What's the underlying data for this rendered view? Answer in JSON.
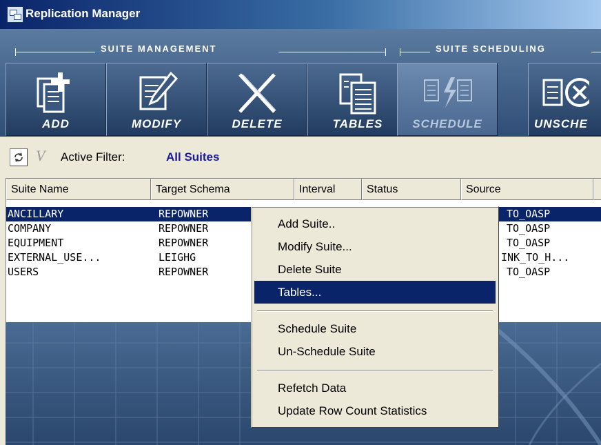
{
  "window": {
    "title": "Replication Manager",
    "icon": "replication-app-icon"
  },
  "toolbar": {
    "sections": [
      {
        "label": "SUITE MANAGEMENT"
      },
      {
        "label": "SUITE SCHEDULING"
      }
    ],
    "buttons": [
      {
        "label": "ADD",
        "icon": "add-document-icon",
        "enabled": true
      },
      {
        "label": "MODIFY",
        "icon": "edit-document-icon",
        "enabled": true
      },
      {
        "label": "DELETE",
        "icon": "delete-x-icon",
        "enabled": true
      },
      {
        "label": "TABLES",
        "icon": "tables-icon",
        "enabled": true
      },
      {
        "label": "SCHEDULE",
        "icon": "schedule-icon",
        "enabled": false
      },
      {
        "label": "UNSCHE",
        "icon": "unschedule-icon",
        "enabled": true
      }
    ]
  },
  "filter_bar": {
    "refresh_icon": "refresh-icon",
    "filter_icon": "filter-icon",
    "active_filter_label": "Active Filter:",
    "active_filter_value": "All Suites"
  },
  "list": {
    "columns": [
      "Suite Name",
      "Target Schema",
      "Interval",
      "Status",
      "Source",
      ""
    ],
    "rows": [
      {
        "suite": "ANCILLARY",
        "schema": "REPOWNER",
        "source": "TO_OASP",
        "selected": true
      },
      {
        "suite": "COMPANY",
        "schema": "REPOWNER",
        "source": "TO_OASP",
        "selected": false
      },
      {
        "suite": "EQUIPMENT",
        "schema": "REPOWNER",
        "source": "TO_OASP",
        "selected": false
      },
      {
        "suite": "EXTERNAL_USE...",
        "schema": "LEIGHG",
        "source": "INK_TO_H...",
        "selected": false
      },
      {
        "suite": "USERS",
        "schema": "REPOWNER",
        "source": "TO_OASP",
        "selected": false
      }
    ]
  },
  "context_menu": {
    "groups": [
      [
        "Add Suite..",
        "Modify Suite...",
        "Delete Suite",
        "Tables..."
      ],
      [
        "Schedule Suite",
        "Un-Schedule Suite"
      ],
      [
        "Refetch Data",
        "Update Row Count Statistics"
      ]
    ],
    "highlighted": "Tables..."
  },
  "colors": {
    "selection": "#0a246a",
    "toolbar": "#3b5a82",
    "filter_value": "#1a1a9a",
    "menu_bg": "#ece9d8"
  }
}
